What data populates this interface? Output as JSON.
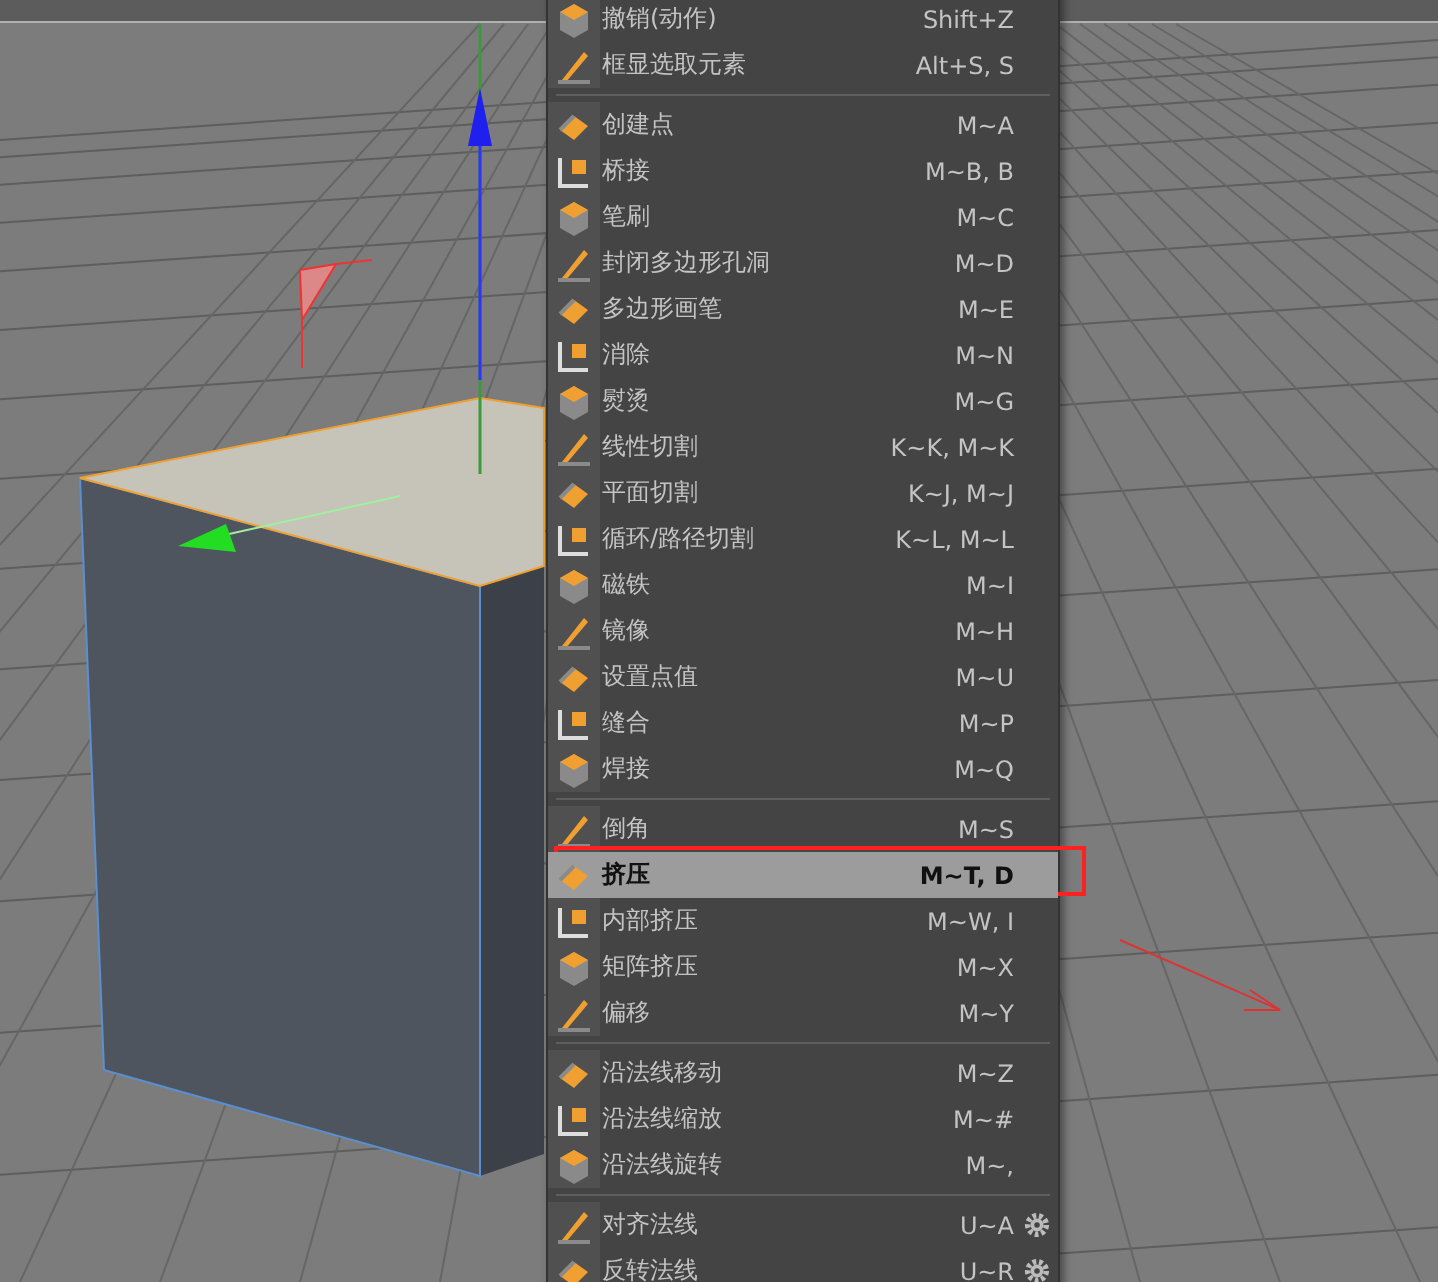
{
  "context_menu": {
    "sections": [
      {
        "items": [
          {
            "label": "撤销(动作)",
            "shortcut": "Shift+Z",
            "selected": false,
            "marked": false,
            "options": false
          },
          {
            "label": "框显选取元素",
            "shortcut": "Alt+S, S",
            "selected": false,
            "marked": false,
            "options": false
          }
        ]
      },
      {
        "items": [
          {
            "label": "创建点",
            "shortcut": "M~A",
            "selected": false,
            "marked": false,
            "options": false
          },
          {
            "label": "桥接",
            "shortcut": "M~B, B",
            "selected": false,
            "marked": false,
            "options": false
          },
          {
            "label": "笔刷",
            "shortcut": "M~C",
            "selected": false,
            "marked": false,
            "options": false
          },
          {
            "label": "封闭多边形孔洞",
            "shortcut": "M~D",
            "selected": false,
            "marked": false,
            "options": false
          },
          {
            "label": "多边形画笔",
            "shortcut": "M~E",
            "selected": false,
            "marked": false,
            "options": false
          },
          {
            "label": "消除",
            "shortcut": "M~N",
            "selected": false,
            "marked": false,
            "options": false
          },
          {
            "label": "熨烫",
            "shortcut": "M~G",
            "selected": false,
            "marked": false,
            "options": false
          },
          {
            "label": "线性切割",
            "shortcut": "K~K, M~K",
            "selected": false,
            "marked": false,
            "options": false
          },
          {
            "label": "平面切割",
            "shortcut": "K~J, M~J",
            "selected": false,
            "marked": false,
            "options": false
          },
          {
            "label": "循环/路径切割",
            "shortcut": "K~L, M~L",
            "selected": false,
            "marked": false,
            "options": false
          },
          {
            "label": "磁铁",
            "shortcut": "M~I",
            "selected": false,
            "marked": false,
            "options": false
          },
          {
            "label": "镜像",
            "shortcut": "M~H",
            "selected": false,
            "marked": false,
            "options": false
          },
          {
            "label": "设置点值",
            "shortcut": "M~U",
            "selected": false,
            "marked": false,
            "options": false
          },
          {
            "label": "缝合",
            "shortcut": "M~P",
            "selected": false,
            "marked": false,
            "options": false
          },
          {
            "label": "焊接",
            "shortcut": "M~Q",
            "selected": false,
            "marked": false,
            "options": false
          }
        ]
      },
      {
        "items": [
          {
            "label": "倒角",
            "shortcut": "M~S",
            "selected": false,
            "marked": false,
            "options": false
          },
          {
            "label": "挤压",
            "shortcut": "M~T, D",
            "selected": true,
            "marked": true,
            "options": false
          },
          {
            "label": "内部挤压",
            "shortcut": "M~W, I",
            "selected": false,
            "marked": false,
            "options": false
          },
          {
            "label": "矩阵挤压",
            "shortcut": "M~X",
            "selected": false,
            "marked": false,
            "options": false
          },
          {
            "label": "偏移",
            "shortcut": "M~Y",
            "selected": false,
            "marked": false,
            "options": false
          }
        ]
      },
      {
        "items": [
          {
            "label": "沿法线移动",
            "shortcut": "M~Z",
            "selected": false,
            "marked": false,
            "options": false
          },
          {
            "label": "沿法线缩放",
            "shortcut": "M~#",
            "selected": false,
            "marked": false,
            "options": false
          },
          {
            "label": "沿法线旋转",
            "shortcut": "M~,",
            "selected": false,
            "marked": false,
            "options": false
          }
        ]
      },
      {
        "items": [
          {
            "label": "对齐法线",
            "shortcut": "U~A",
            "selected": false,
            "marked": false,
            "options": true
          },
          {
            "label": "反转法线",
            "shortcut": "U~R",
            "selected": false,
            "marked": false,
            "options": true
          }
        ]
      }
    ]
  }
}
